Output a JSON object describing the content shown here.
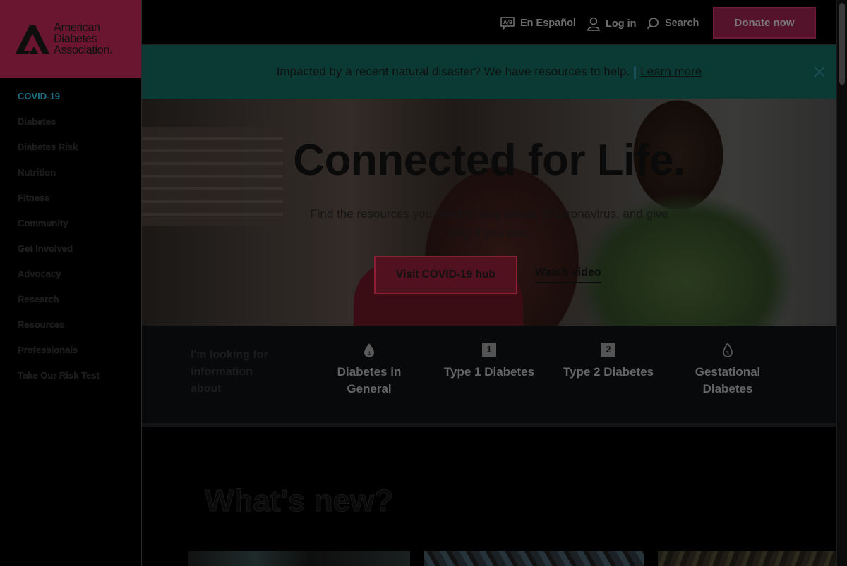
{
  "logo": {
    "line1": "American",
    "line2": "Diabetes",
    "line3": "Association."
  },
  "sidebar": {
    "items": [
      {
        "label": "COVID-19"
      },
      {
        "label": "Diabetes"
      },
      {
        "label": "Diabetes Risk"
      },
      {
        "label": "Nutrition"
      },
      {
        "label": "Fitness"
      },
      {
        "label": "Community"
      },
      {
        "label": "Get Involved"
      },
      {
        "label": "Advocacy"
      },
      {
        "label": "Research"
      },
      {
        "label": "Resources"
      },
      {
        "label": "Professionals"
      },
      {
        "label": "Take Our Risk Test"
      }
    ]
  },
  "header": {
    "espanol": "En Español",
    "login": "Log in",
    "search": "Search",
    "donate": "Donate now"
  },
  "alert": {
    "text": "Impacted by a recent natural disaster? We have resources to help.",
    "link": "Learn more"
  },
  "hero": {
    "title": "Connected for Life.",
    "subtitle": "Find the resources you need to stay ahead of coronavirus, and give help if you can.",
    "primary_button": "Visit COVID-19 hub",
    "secondary_link": "Watch video"
  },
  "info": {
    "label": "I'm looking for information about",
    "categories": [
      {
        "label": "Diabetes in General",
        "icon": "drop-icon"
      },
      {
        "label": "Type 1 Diabetes",
        "badge": "1"
      },
      {
        "label": "Type 2 Diabetes",
        "badge": "2"
      },
      {
        "label": "Gestational Diabetes",
        "icon": "drop-3-icon"
      }
    ]
  },
  "whats_new": {
    "title": "What's new?"
  },
  "colors": {
    "brand_maroon": "#6a1630",
    "alert_teal": "#0b3a35",
    "active_link": "#1d6f80"
  }
}
